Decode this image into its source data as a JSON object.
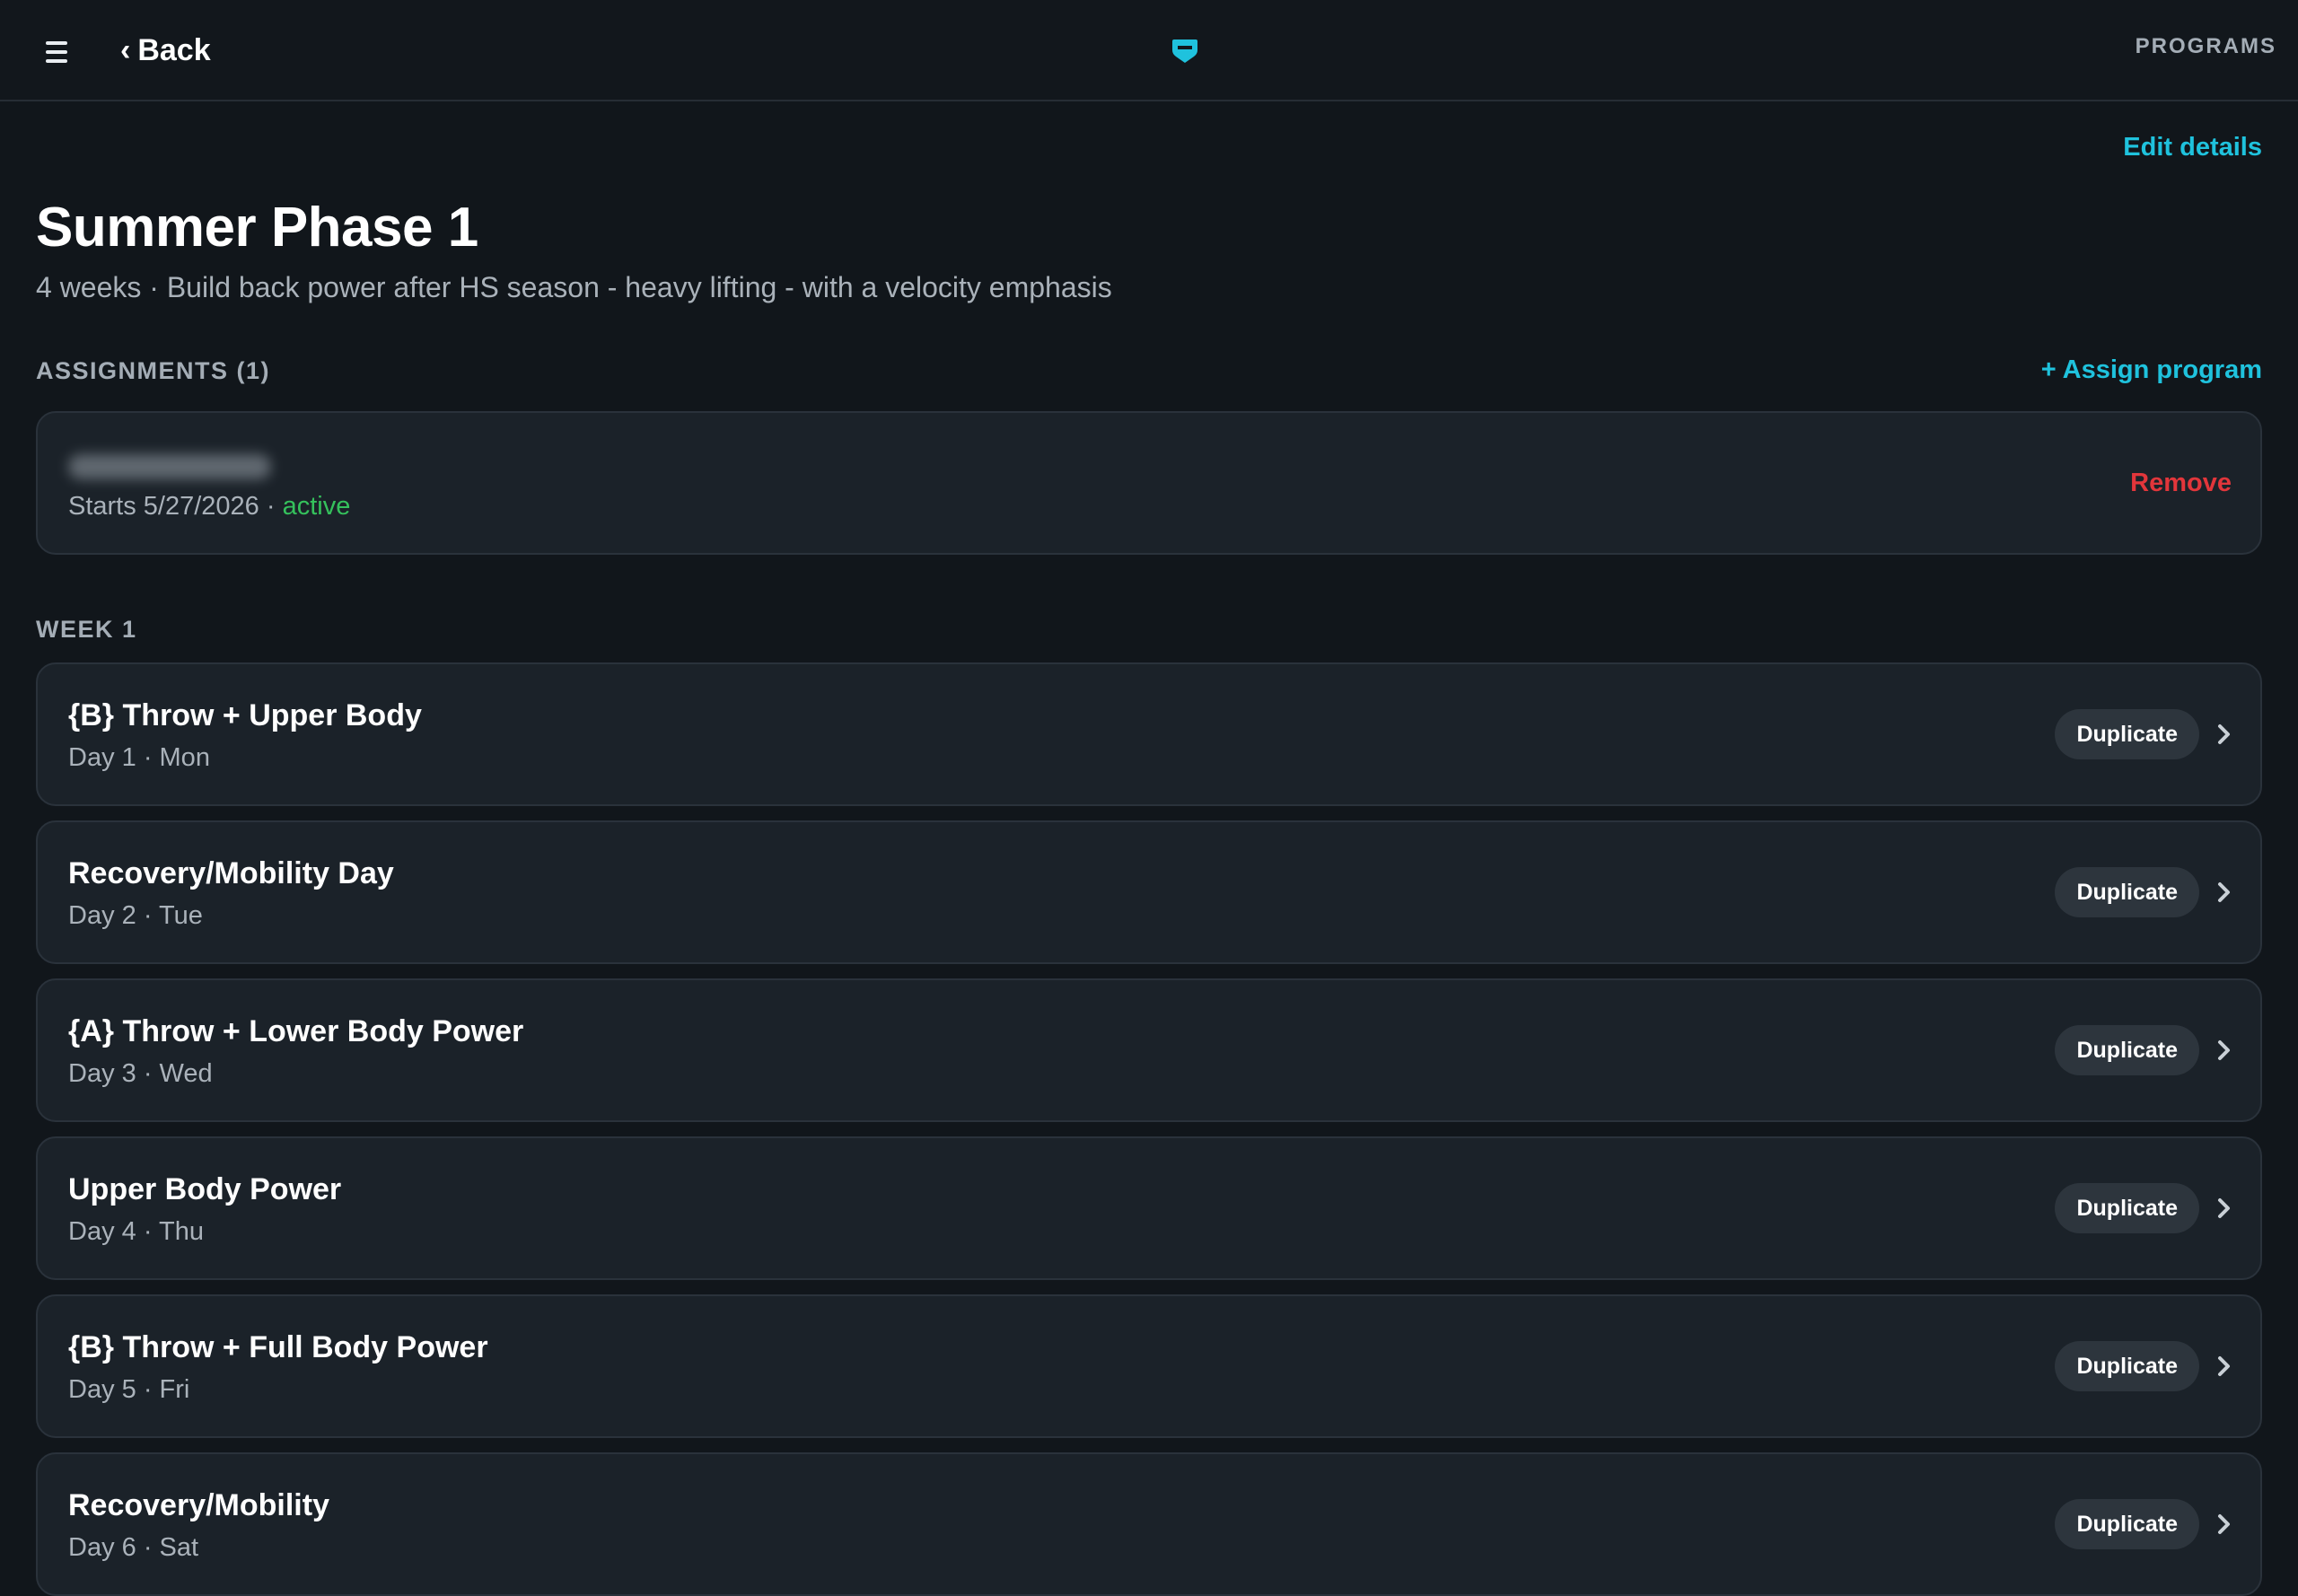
{
  "topbar": {
    "back_label": "Back",
    "programs_label": "PROGRAMS",
    "logo_icon": "shield-logo-icon",
    "accent_color": "#1fc2dd"
  },
  "program": {
    "edit_label": "Edit details",
    "title": "Summer Phase 1",
    "subtitle": "4 weeks · Build back power after HS season - heavy lifting - with a velocity emphasis"
  },
  "assignments": {
    "heading": "ASSIGNMENTS (1)",
    "assign_label": "+ Assign program",
    "items": [
      {
        "starts": "Starts 5/27/2026 · ",
        "status": "active",
        "remove_label": "Remove"
      }
    ]
  },
  "week": {
    "heading": "WEEK 1",
    "duplicate_label": "Duplicate",
    "days": [
      {
        "title": "{B} Throw + Upper Body",
        "sub": "Day 1 · Mon"
      },
      {
        "title": "Recovery/Mobility Day",
        "sub": "Day 2 · Tue"
      },
      {
        "title": "{A} Throw + Lower Body Power",
        "sub": "Day 3 · Wed"
      },
      {
        "title": "Upper Body Power",
        "sub": "Day 4 · Thu"
      },
      {
        "title": "{B} Throw + Full Body Power",
        "sub": "Day 5 · Fri"
      },
      {
        "title": "Recovery/Mobility",
        "sub": "Day 6 · Sat"
      }
    ]
  }
}
